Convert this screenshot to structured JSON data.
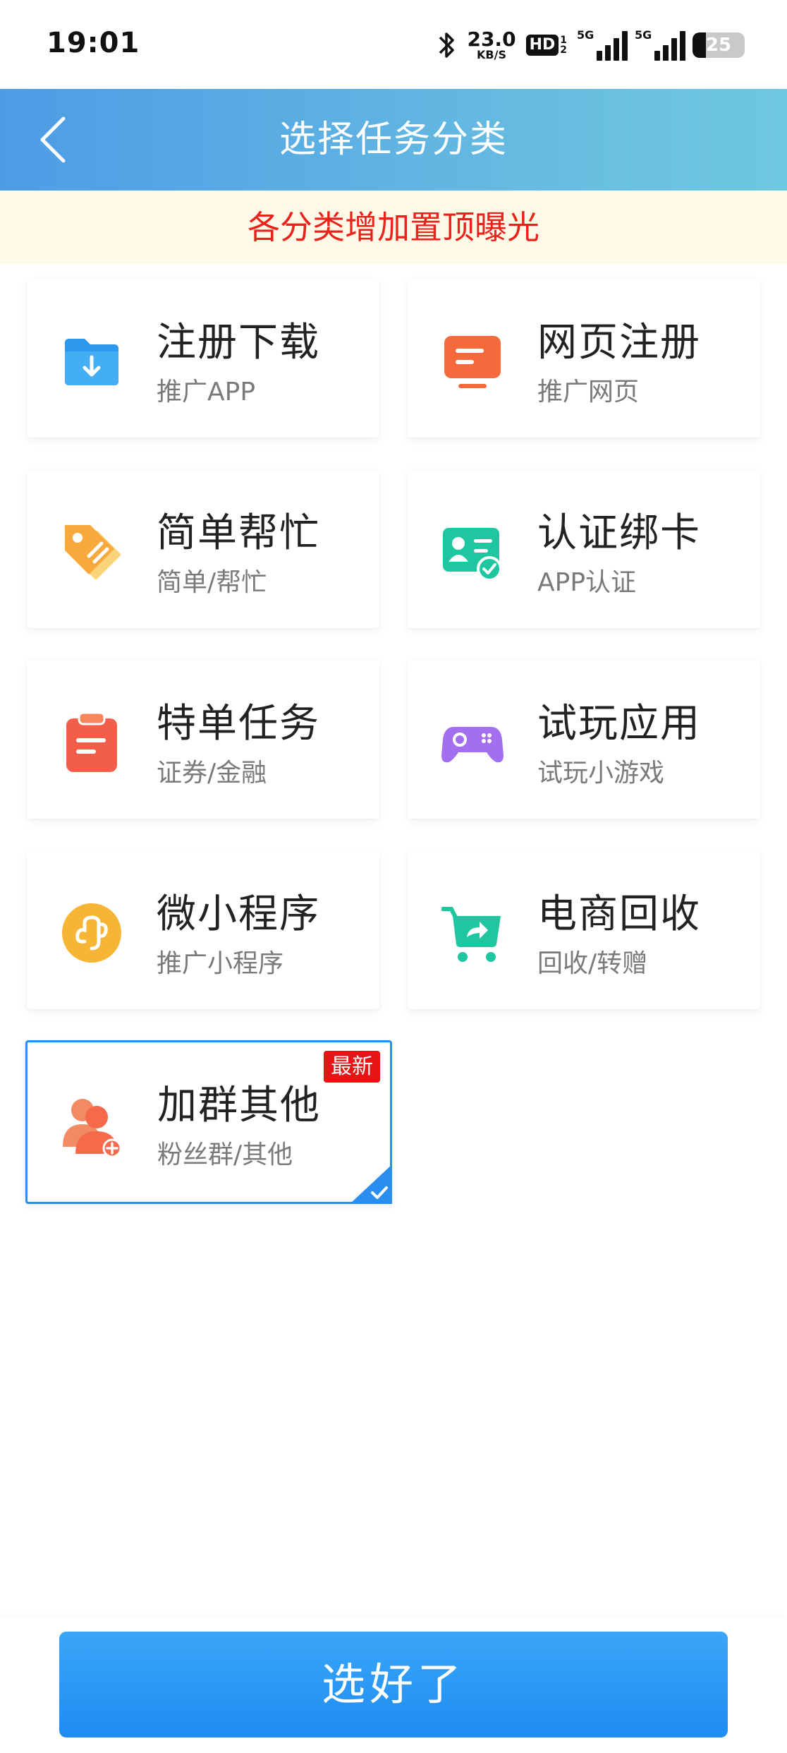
{
  "status_bar": {
    "time": "19:01",
    "speed_value": "23.0",
    "speed_unit": "KB/S",
    "hd_label": "HD",
    "hd_sub_top": "1",
    "hd_sub_bottom": "2",
    "signal1_label": "5G",
    "signal2_label": "5G",
    "battery": "25",
    "battery_level": 0.25
  },
  "nav": {
    "title": "选择任务分类"
  },
  "notice": {
    "text": "各分类增加置顶曝光"
  },
  "categories": [
    {
      "title": "注册下载",
      "subtitle": "推广APP",
      "icon": "folder-download-icon",
      "color": "#2d9af0"
    },
    {
      "title": "网页注册",
      "subtitle": "推广网页",
      "icon": "monitor-icon",
      "color": "#f46a3c"
    },
    {
      "title": "简单帮忙",
      "subtitle": "简单/帮忙",
      "icon": "tag-icon",
      "color": "#f7a93b"
    },
    {
      "title": "认证绑卡",
      "subtitle": "APP认证",
      "icon": "id-card-icon",
      "color": "#1fc7a0"
    },
    {
      "title": "特单任务",
      "subtitle": "证券/金融",
      "icon": "clipboard-icon",
      "color": "#f25e4a"
    },
    {
      "title": "试玩应用",
      "subtitle": "试玩小游戏",
      "icon": "gamepad-icon",
      "color": "#a46ef0"
    },
    {
      "title": "微小程序",
      "subtitle": "推广小程序",
      "icon": "mini-program-icon",
      "color": "#f7b535"
    },
    {
      "title": "电商回收",
      "subtitle": "回收/转赠",
      "icon": "cart-share-icon",
      "color": "#1fc7a0"
    },
    {
      "title": "加群其他",
      "subtitle": "粉丝群/其他",
      "icon": "group-add-icon",
      "color": "#f46a4a",
      "badge": "最新",
      "selected": true
    }
  ],
  "confirm": {
    "label": "选好了"
  }
}
